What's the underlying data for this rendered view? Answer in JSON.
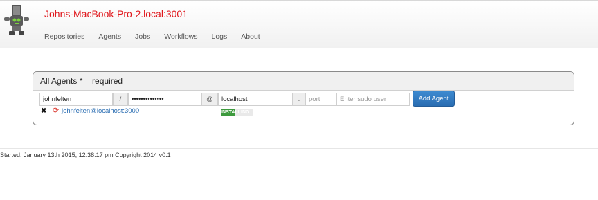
{
  "navbar": {
    "brand": "Johns-MacBook-Pro-2.local:3001",
    "items": [
      {
        "label": "Repositories"
      },
      {
        "label": "Agents"
      },
      {
        "label": "Jobs"
      },
      {
        "label": "Workflows"
      },
      {
        "label": "Logs"
      },
      {
        "label": "About"
      }
    ]
  },
  "panel": {
    "title": "All Agents * = required"
  },
  "form": {
    "username_value": "johnfelten",
    "separator_slash": "/",
    "password_value": "••••••••••••••",
    "separator_at": "@",
    "host_value": "localhost",
    "separator_colon": ":",
    "port_placeholder": "port",
    "sudo_placeholder": "Enter sudo user",
    "add_button_label": "Add Agent"
  },
  "agents": [
    {
      "name": "johnfelten@localhost:3000",
      "status_label": "INSTALLING",
      "progress_percent": 45,
      "remove_icon": "close-icon",
      "refresh_icon": "refresh-icon"
    }
  ],
  "footer": {
    "text": "Started: January 13th 2015, 12:38:17 pm Copyright 2014 v0.1"
  },
  "colors": {
    "brand": "#e0161b",
    "button": "#2a6db2",
    "link": "#2a6db2",
    "progress": "#3d9a3d"
  }
}
